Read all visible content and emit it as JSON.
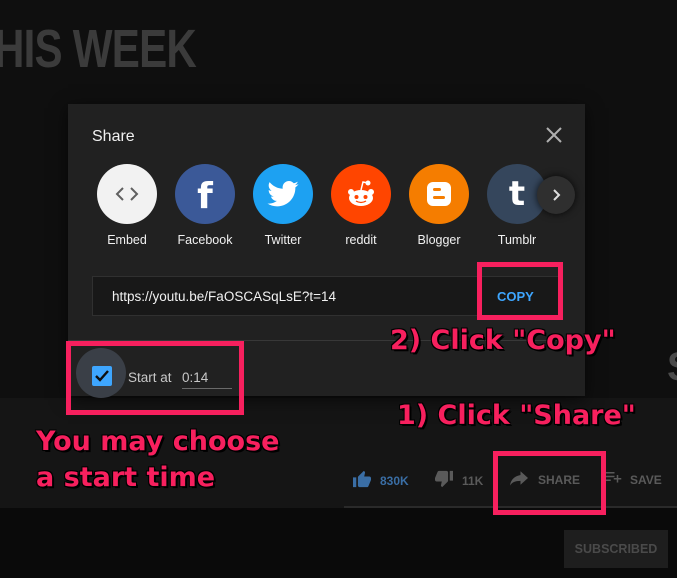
{
  "background": {
    "video_title_fragment": "HIS WEEK",
    "edge_glyph": "S",
    "actions": [
      {
        "icon": "thumbs-up-icon",
        "label": "830K"
      },
      {
        "icon": "thumbs-down-icon",
        "label": "11K"
      },
      {
        "icon": "share-arrow-icon",
        "label": "SHARE"
      },
      {
        "icon": "playlist-add-icon",
        "label": "SAVE"
      }
    ],
    "subscribe_label": "SUBSCRIBED"
  },
  "dialog": {
    "title": "Share",
    "close_icon": "close-icon",
    "targets": [
      {
        "label": "Embed",
        "icon": "embed-code-icon",
        "color": "#f2f2f2"
      },
      {
        "label": "Facebook",
        "icon": "facebook-icon",
        "color": "#3b5998"
      },
      {
        "label": "Twitter",
        "icon": "twitter-icon",
        "color": "#1da1f2"
      },
      {
        "label": "reddit",
        "icon": "reddit-icon",
        "color": "#ff4500"
      },
      {
        "label": "Blogger",
        "icon": "blogger-icon",
        "color": "#f57d00"
      },
      {
        "label": "Tumblr",
        "icon": "tumblr-icon",
        "color": "#35465c"
      }
    ],
    "next_icon": "chevron-right-icon",
    "url": "https://youtu.be/FaOSCASqLsE?t=14",
    "copy_label": "COPY",
    "start_at": {
      "label": "Start at",
      "time": "0:14",
      "checked": true
    }
  },
  "annotations": {
    "step1": "1) Click \"Share\"",
    "step2": "2) Click \"Copy\"",
    "start_time_note_line1": "You may choose",
    "start_time_note_line2": "a start time"
  },
  "colors": {
    "accent": "#3ea6ff",
    "annotation": "#f7205e",
    "dialog_bg": "#212121"
  }
}
